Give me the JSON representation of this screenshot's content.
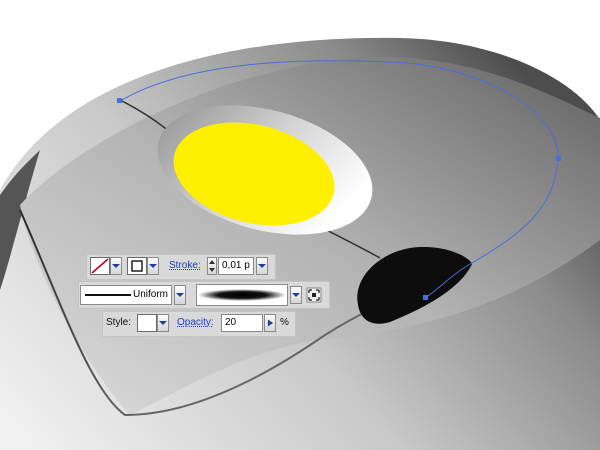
{
  "control_panel": {
    "stroke_label": "Stroke:",
    "stroke_weight": "0,01 p",
    "profile_label": "Uniform",
    "style_label": "Style:",
    "opacity_label": "Opacity:",
    "opacity_value": "20",
    "percent_sign": "%"
  },
  "colors": {
    "accent_yellow": "#ffef00",
    "anchor_blue": "#4a6fd8",
    "link_blue": "#1a3fb5"
  },
  "icons": {
    "fill_swatch": "none-swatch-icon",
    "stroke_swatch": "stroke-square-icon",
    "brush_options": "brush-options-icon"
  }
}
